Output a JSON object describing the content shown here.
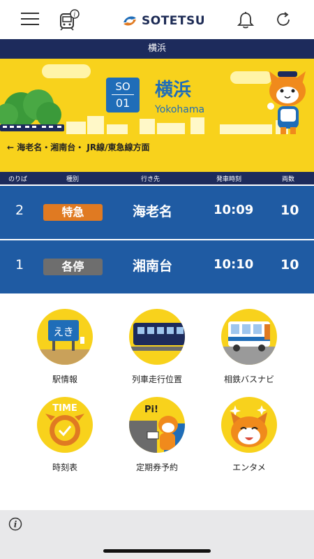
{
  "header": {
    "brand": "SOTETSU",
    "brand_color": "#1d2b55",
    "icons": [
      "menu-icon",
      "train-info-icon",
      "bell-icon",
      "refresh-icon"
    ]
  },
  "station": {
    "bar_title": "横浜",
    "code_line": "SO",
    "code_number": "01",
    "name_ja": "横浜",
    "name_en": "Yokohama",
    "direction": "← 海老名・湘南台・ JR線/東急線方面"
  },
  "table": {
    "headers": [
      "のりば",
      "種別",
      "行き先",
      "発車時刻",
      "両数"
    ],
    "rows": [
      {
        "track": "2",
        "type": "特急",
        "type_color": "#e07a22",
        "destination": "海老名",
        "time": "10:09",
        "cars": "10"
      },
      {
        "track": "1",
        "type": "各停",
        "type_color": "#6e6e6e",
        "destination": "湘南台",
        "time": "10:10",
        "cars": "10"
      }
    ]
  },
  "menu": {
    "items": [
      {
        "label": "駅情報",
        "icon": "station-info-icon"
      },
      {
        "label": "列車走行位置",
        "icon": "train-position-icon"
      },
      {
        "label": "相鉄バスナビ",
        "icon": "bus-navi-icon"
      },
      {
        "label": "時刻表",
        "icon": "timetable-icon",
        "icon_text": "TIME"
      },
      {
        "label": "定期券予約",
        "icon": "commuter-pass-icon",
        "icon_text": "Pi!"
      },
      {
        "label": "エンタメ",
        "icon": "entertainment-icon"
      }
    ],
    "station_sign_text": "えき"
  },
  "colors": {
    "navy": "#1d2b5c",
    "row_blue": "#1f5ba3",
    "yellow": "#f8d21c",
    "station_blue": "#1f6db8"
  }
}
